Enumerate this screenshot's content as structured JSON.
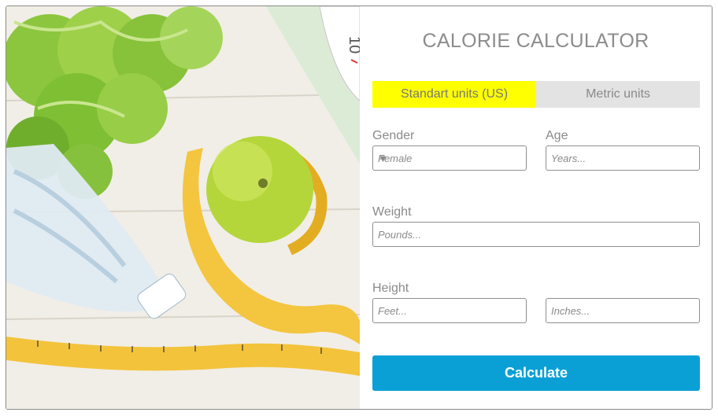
{
  "title": "CALORIE CALCULATOR",
  "tabs": [
    {
      "label": "Standart units (US)",
      "active": true
    },
    {
      "label": "Metric units",
      "active": false
    }
  ],
  "form": {
    "gender": {
      "label": "Gender",
      "selected": "Female"
    },
    "age": {
      "label": "Age",
      "placeholder": "Years..."
    },
    "weight": {
      "label": "Weight",
      "placeholder": "Pounds..."
    },
    "height": {
      "label": "Height",
      "feet_placeholder": "Feet...",
      "inches_placeholder": "Inches..."
    }
  },
  "calculate_button": "Calculate",
  "photo": {
    "scale_dial_text": "10"
  },
  "colors": {
    "active_tab": "#ffff00",
    "inactive_tab": "#e3e3e3",
    "button": "#0aa0d6",
    "text_gray": "#8a8a8a"
  }
}
